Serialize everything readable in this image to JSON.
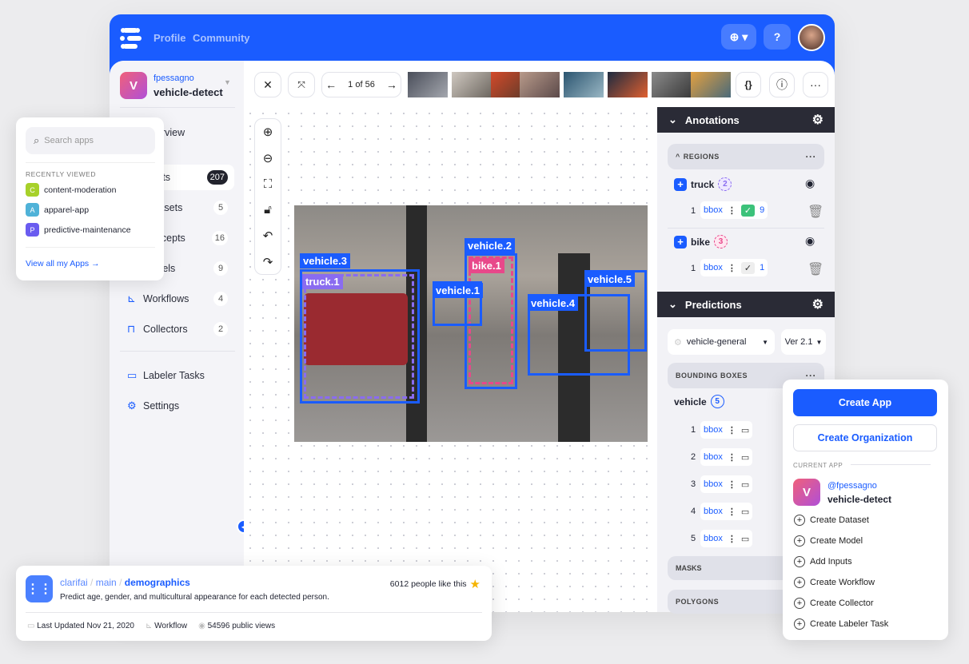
{
  "topbar": {
    "nav": [
      "Profile",
      "Community"
    ],
    "add_icon": "plus-circle-icon",
    "help_icon": "question-icon"
  },
  "app": {
    "owner": "fpessagno",
    "slash": "/",
    "name": "vehicle-detect",
    "initial": "V"
  },
  "sidebar": {
    "items": [
      {
        "label": "Overview"
      },
      {
        "label": "Inputs",
        "count": "207"
      },
      {
        "label": "Datasets",
        "count": "5"
      },
      {
        "label": "Concepts",
        "count": "16"
      },
      {
        "label": "Models",
        "count": "9"
      },
      {
        "label": "Workflows",
        "count": "4"
      },
      {
        "label": "Collectors",
        "count": "2"
      }
    ],
    "bottom": [
      {
        "label": "Labeler Tasks"
      },
      {
        "label": "Settings"
      }
    ]
  },
  "toolbar": {
    "pager": "1 of 56",
    "code_label": "{}"
  },
  "boxes": [
    {
      "label": "vehicle.3"
    },
    {
      "label": "truck.1"
    },
    {
      "label": "vehicle.2"
    },
    {
      "label": "bike.1"
    },
    {
      "label": "vehicle.1"
    },
    {
      "label": "vehicle.4"
    },
    {
      "label": "vehicle.5"
    }
  ],
  "annotations": {
    "title": "Anotations",
    "regions_label": "REGIONS",
    "items": [
      {
        "name": "truck",
        "count": "2",
        "row": "1",
        "type": "bbox",
        "votes": "9"
      },
      {
        "name": "bike",
        "count": "3",
        "row": "1",
        "type": "bbox",
        "votes": "1"
      }
    ]
  },
  "predictions": {
    "title": "Predictions",
    "model": "vehicle-general",
    "version": "Ver 2.1",
    "bbox_label": "BOUNDING BOXES",
    "concept": "vehicle",
    "concept_count": "5",
    "rows": [
      "1",
      "2",
      "3",
      "4",
      "5"
    ],
    "type": "bbox",
    "masks_label": "MASKS",
    "polygons_label": "POLYGONS"
  },
  "search_popup": {
    "placeholder": "Search apps",
    "recent_label": "RECENTLY VIEWED",
    "apps": [
      {
        "initial": "C",
        "name": "content-moderation",
        "color": "#a7d12a"
      },
      {
        "initial": "A",
        "name": "apparel-app",
        "color": "#4fb2d8"
      },
      {
        "initial": "P",
        "name": "predictive-maintenance",
        "color": "#6a5cf0"
      }
    ],
    "view_all": "View all my Apps →"
  },
  "create_popup": {
    "create_app": "Create App",
    "create_org": "Create Organization",
    "current_label": "CURRENT APP",
    "owner": "@fpessagno",
    "slash": "/",
    "app": "vehicle-detect",
    "initial": "V",
    "actions": [
      "Create Dataset",
      "Create Model",
      "Add Inputs",
      "Create Workflow",
      "Create Collector",
      "Create Labeler Task"
    ]
  },
  "model_card": {
    "owner": "clarifai",
    "app": "main",
    "model": "demographics",
    "likes": "6012 people like this",
    "description": "Predict age, gender, and multicultural appearance for each detected person.",
    "updated": "Last Updated Nov 21, 2020",
    "type": "Workflow",
    "views": "54596 public views"
  },
  "colors": {
    "brand": "#1a5cff",
    "dark": "#2a2b36",
    "pink": "#e8488a",
    "purple": "#8a6cf0"
  }
}
